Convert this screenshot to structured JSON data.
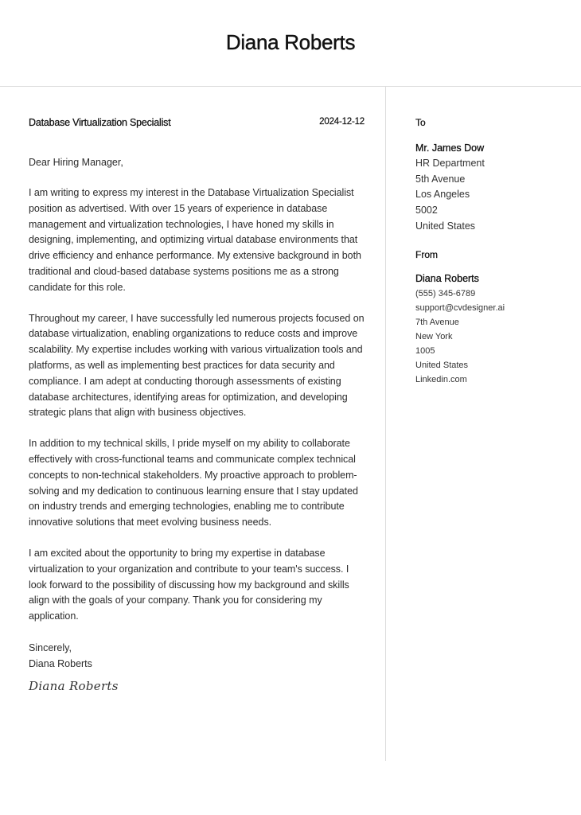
{
  "header": {
    "name": "Diana Roberts"
  },
  "letter": {
    "job_title": "Database Virtualization Specialist",
    "date": "2024-12-12",
    "salutation": "Dear Hiring Manager,",
    "paragraphs": [
      "I am writing to express my interest in the Database Virtualization Specialist position as advertised. With over 15 years of experience in database management and virtualization technologies, I have honed my skills in designing, implementing, and optimizing virtual database environments that drive efficiency and enhance performance. My extensive background in both traditional and cloud-based database systems positions me as a strong candidate for this role.",
      "Throughout my career, I have successfully led numerous projects focused on database virtualization, enabling organizations to reduce costs and improve scalability. My expertise includes working with various virtualization tools and platforms, as well as implementing best practices for data security and compliance. I am adept at conducting thorough assessments of existing database architectures, identifying areas for optimization, and developing strategic plans that align with business objectives.",
      "In addition to my technical skills, I pride myself on my ability to collaborate effectively with cross-functional teams and communicate complex technical concepts to non-technical stakeholders. My proactive approach to problem-solving and my dedication to continuous learning ensure that I stay updated on industry trends and emerging technologies, enabling me to contribute innovative solutions that meet evolving business needs.",
      "I am excited about the opportunity to bring my expertise in database virtualization to your organization and contribute to your team's success. I look forward to the possibility of discussing how my background and skills align with the goals of your company. Thank you for considering my application."
    ],
    "closing": "Sincerely,",
    "closing_name": "Diana Roberts",
    "signature": "Diana Roberts"
  },
  "recipient": {
    "label": "To",
    "name": "Mr. James Dow",
    "department": "HR Department",
    "street": "5th Avenue",
    "city": "Los Angeles",
    "zip": "5002",
    "country": "United States"
  },
  "sender": {
    "label": "From",
    "name": "Diana Roberts",
    "phone": "(555) 345-6789",
    "email": "support@cvdesigner.ai",
    "street": "7th Avenue",
    "city": "New York",
    "zip": "1005",
    "country": "United States",
    "website": "Linkedin.com"
  }
}
